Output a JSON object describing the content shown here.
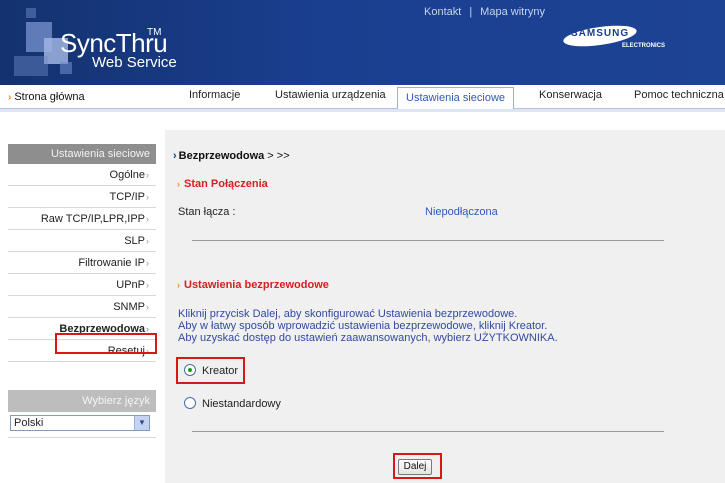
{
  "header": {
    "logo_main": "SyncThru",
    "logo_tm": "TM",
    "logo_sub": "Web Service",
    "top_links": [
      "Kontakt",
      "Mapa witryny"
    ],
    "brand_name": "SAMSUNG",
    "brand_sub": "ELECTRONICS"
  },
  "nav": {
    "home": "Strona główna",
    "tabs": [
      "Informacje",
      "Ustawienia urządzenia",
      "Ustawienia sieciowe",
      "Konserwacja",
      "Pomoc techniczna"
    ],
    "active_tab": "Ustawienia sieciowe"
  },
  "sidebar": {
    "header": "Ustawienia sieciowe",
    "items": [
      "Ogólne",
      "TCP/IP",
      "Raw TCP/IP,LPR,IPP",
      "SLP",
      "Filtrowanie IP",
      "UPnP",
      "SNMP",
      "Bezprzewodowa",
      "Resetuj"
    ],
    "active_item": "Bezprzewodowa",
    "language_header": "Wybierz język",
    "language_selected": "Polski"
  },
  "content": {
    "breadcrumb_main": "Bezprzewodowa",
    "breadcrumb_tail": " > >>",
    "status_title": "Stan Połączenia",
    "link_label": "Stan łącza :",
    "link_value": "Niepodłączona",
    "settings_title": "Ustawienia bezprzewodowe",
    "desc_lines": [
      "Kliknij przycisk Dalej, aby skonfigurować Ustawienia bezprzewodowe.",
      "Aby w łatwy sposób wprowadzić ustawienia bezprzewodowe, kliknij Kreator.",
      "Aby uzyskać dostęp do ustawień zaawansowanych, wybierz UŻYTKOWNIKA."
    ],
    "radio_options": [
      "Kreator",
      "Niestandardowy"
    ],
    "radio_selected": "Kreator",
    "next_button": "Dalej"
  },
  "colors": {
    "header_blue": "#1b3f90",
    "highlight_red": "#d81818",
    "section_red": "#d62020",
    "link_blue": "#2f5bb5"
  },
  "icons": [
    "chevron-right-icon",
    "radio-icon",
    "dropdown-arrow-icon"
  ]
}
